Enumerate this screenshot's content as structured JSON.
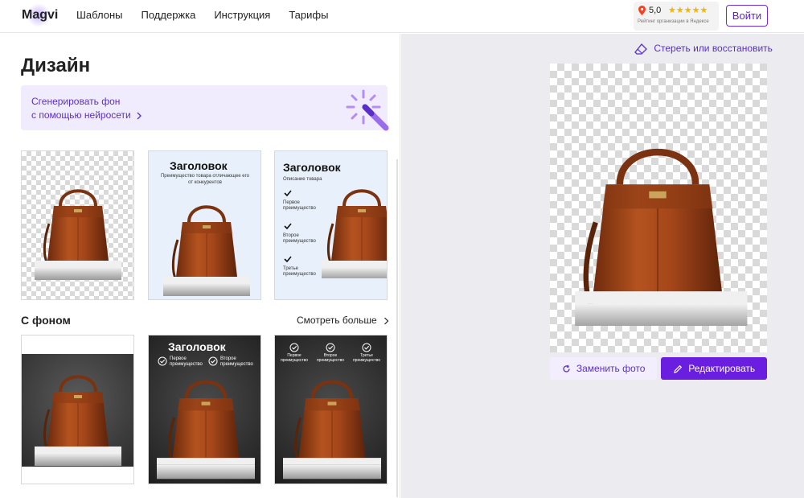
{
  "header": {
    "logo": "Magvi",
    "nav": [
      "Шаблоны",
      "Поддержка",
      "Инструкция",
      "Тарифы"
    ],
    "rating": {
      "score": "5,0",
      "stars": "★★★★★",
      "caption": "Рейтинг организации в Яндексе"
    },
    "login_label": "Войти"
  },
  "left": {
    "title": "Дизайн",
    "ai_banner": {
      "line1": "Сгенерировать фон",
      "line2": "с помощью нейросети"
    },
    "templates": [
      {
        "kind": "transparent"
      },
      {
        "kind": "infographic",
        "heading": "Заголовок",
        "subtitle": "Преимущество товара отличающее его от конкурентов"
      },
      {
        "kind": "infographic-list",
        "heading": "Заголовок",
        "subtitle": "Описание товара",
        "points": [
          "Первое преимущество",
          "Второе преимущество",
          "Третье преимущество"
        ]
      }
    ],
    "section_title": "С фоном",
    "more_label": "Смотреть больше",
    "bg_templates": [
      {
        "kind": "dark-bg"
      },
      {
        "kind": "dark-heading",
        "heading": "Заголовок",
        "points": [
          "Первое преимущество",
          "Второе преимущество"
        ]
      },
      {
        "kind": "dark-three",
        "points": [
          "Первое преимущество",
          "Второе преимущество",
          "Третье преимущество"
        ]
      }
    ]
  },
  "right": {
    "erase_label": "Стереть или восстановить",
    "replace_label": "Заменить фото",
    "edit_label": "Редактировать"
  },
  "colors": {
    "accent": "#6a1fe0",
    "accent_text": "#5a2fc9",
    "bag": "#a0461c",
    "banner_bg": "#f1ecfd"
  }
}
